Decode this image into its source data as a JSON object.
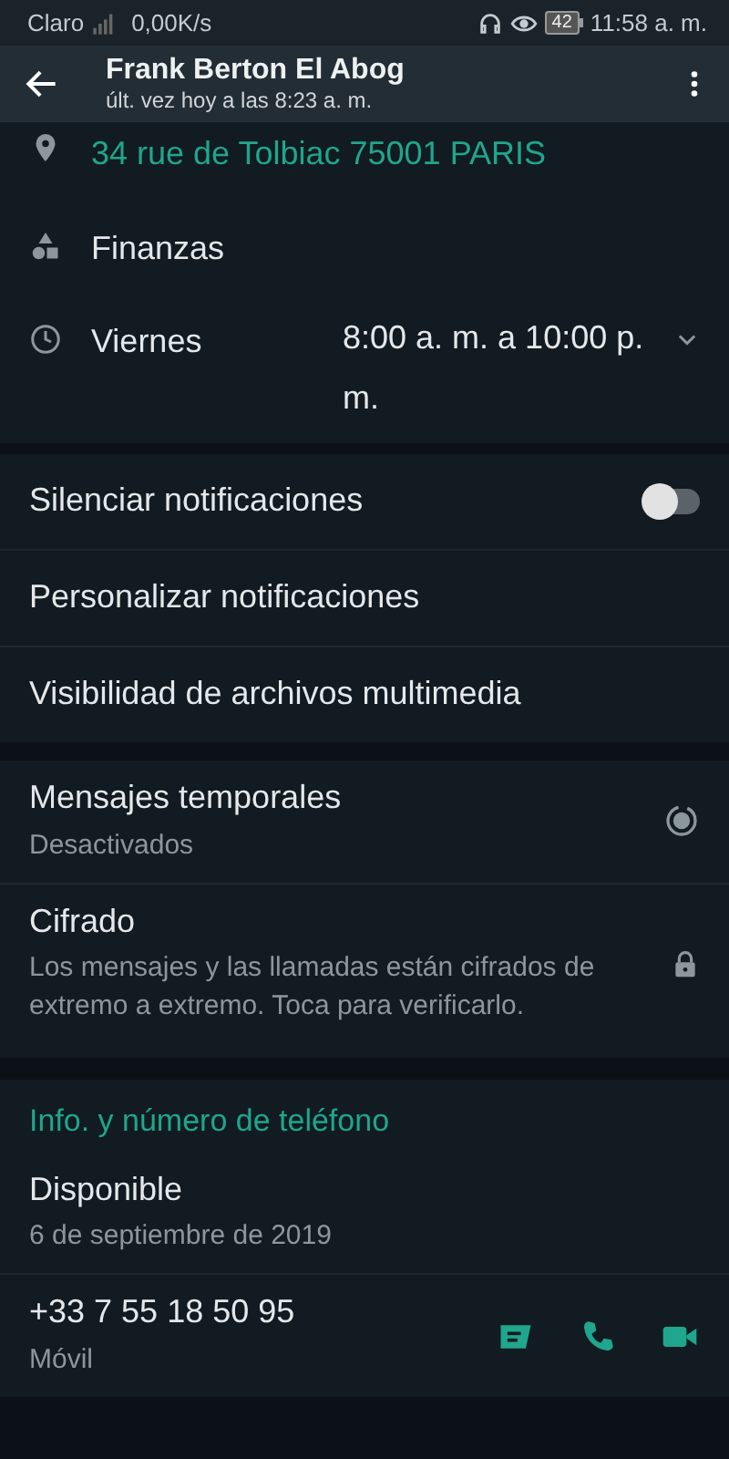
{
  "status_bar": {
    "carrier": "Claro",
    "speed": "0,00K/s",
    "battery": "42",
    "time": "11:58 a. m."
  },
  "header": {
    "title": "Frank Berton El Abog",
    "subtitle": "últ. vez hoy a las 8:23 a. m."
  },
  "business": {
    "address": "34 rue de Tolbiac 75001 PARIS",
    "category": "Finanzas",
    "hours": {
      "day": "Viernes",
      "time": "8:00 a. m. a 10:00 p. m.",
      "expanded": false
    }
  },
  "settings": [
    {
      "label": "Silenciar notificaciones",
      "kind": "toggle",
      "on": false
    },
    {
      "label": "Personalizar notificaciones",
      "kind": "plain"
    },
    {
      "label": "Visibilidad de archivos multimedia",
      "kind": "plain"
    }
  ],
  "privacy": [
    {
      "title": "Mensajes temporales",
      "subtitle": "Desactivados",
      "kind": "timer"
    },
    {
      "title": "Cifrado",
      "subtitle": "Los mensajes y las llamadas están cifrados de extremo a extremo. Toca para verificarlo.",
      "kind": "lock"
    }
  ],
  "about": {
    "heading": "Info. y número de teléfono",
    "status": "Disponible",
    "date": "6 de septiembre de 2019",
    "phone": "+33 7 55 18 50 95",
    "phone_type": "Móvil"
  }
}
